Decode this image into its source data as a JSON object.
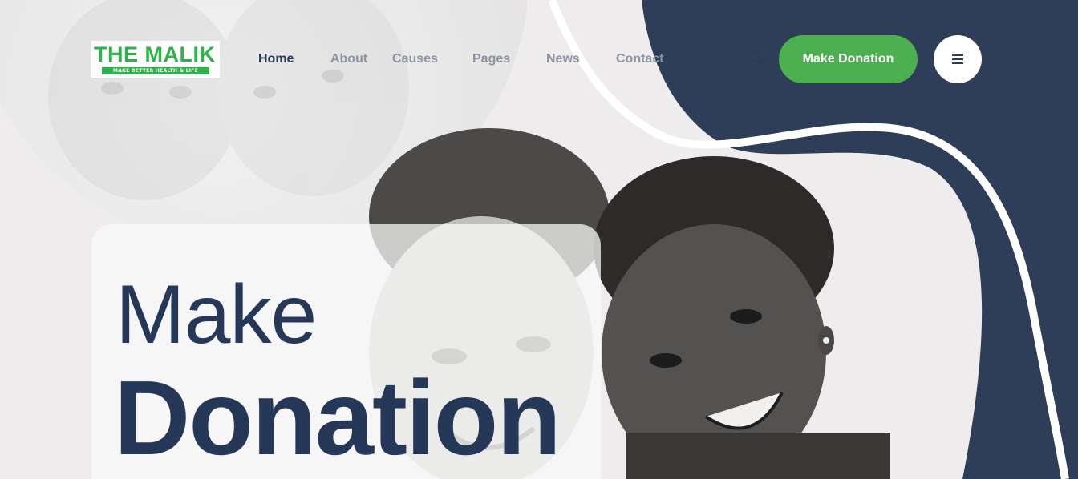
{
  "brand": {
    "name": "THE MALIK",
    "tagline": "MAKE BETTER HEALTH & LIFE",
    "logo_color": "#2eb34a"
  },
  "nav": {
    "items": [
      {
        "label": "Home",
        "active": true
      },
      {
        "label": "About",
        "active": false
      },
      {
        "label": "Causes",
        "active": false
      },
      {
        "label": "Pages",
        "active": false
      },
      {
        "label": "News",
        "active": false
      },
      {
        "label": "Contact",
        "active": false
      }
    ],
    "search_icon": "search-icon",
    "cta_label": "Make Donation",
    "menu_icon": "hamburger-menu-icon"
  },
  "hero": {
    "line1": "Make",
    "line2": "Donation",
    "image": "children-smiling-photo"
  },
  "colors": {
    "navy": "#2e3e58",
    "accent_green": "#4caf50",
    "background": "#efeced",
    "active_nav": "#2a3b58",
    "inactive_nav": "#8d93a1"
  }
}
